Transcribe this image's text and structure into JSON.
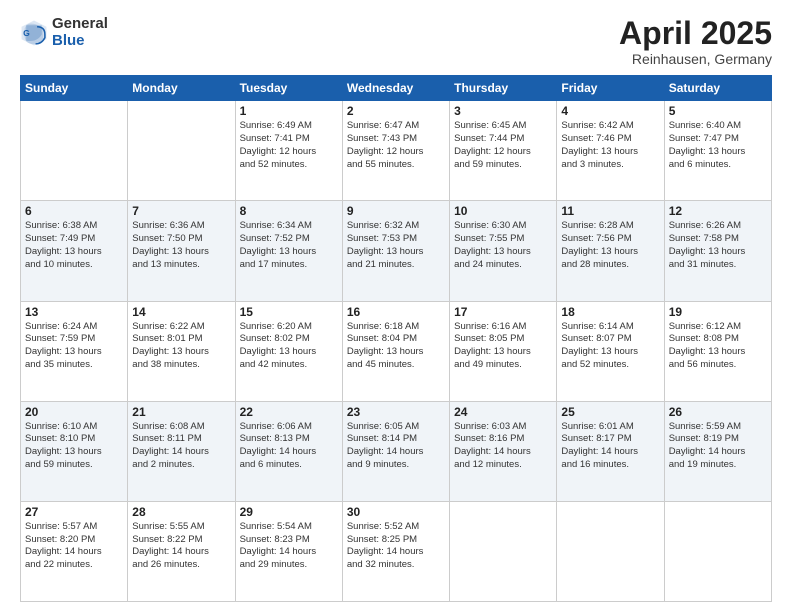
{
  "logo": {
    "general": "General",
    "blue": "Blue"
  },
  "header": {
    "title": "April 2025",
    "subtitle": "Reinhausen, Germany"
  },
  "days_of_week": [
    "Sunday",
    "Monday",
    "Tuesday",
    "Wednesday",
    "Thursday",
    "Friday",
    "Saturday"
  ],
  "weeks": [
    [
      {
        "day": null,
        "info": null
      },
      {
        "day": null,
        "info": null
      },
      {
        "day": "1",
        "info": "Sunrise: 6:49 AM\nSunset: 7:41 PM\nDaylight: 12 hours\nand 52 minutes."
      },
      {
        "day": "2",
        "info": "Sunrise: 6:47 AM\nSunset: 7:43 PM\nDaylight: 12 hours\nand 55 minutes."
      },
      {
        "day": "3",
        "info": "Sunrise: 6:45 AM\nSunset: 7:44 PM\nDaylight: 12 hours\nand 59 minutes."
      },
      {
        "day": "4",
        "info": "Sunrise: 6:42 AM\nSunset: 7:46 PM\nDaylight: 13 hours\nand 3 minutes."
      },
      {
        "day": "5",
        "info": "Sunrise: 6:40 AM\nSunset: 7:47 PM\nDaylight: 13 hours\nand 6 minutes."
      }
    ],
    [
      {
        "day": "6",
        "info": "Sunrise: 6:38 AM\nSunset: 7:49 PM\nDaylight: 13 hours\nand 10 minutes."
      },
      {
        "day": "7",
        "info": "Sunrise: 6:36 AM\nSunset: 7:50 PM\nDaylight: 13 hours\nand 13 minutes."
      },
      {
        "day": "8",
        "info": "Sunrise: 6:34 AM\nSunset: 7:52 PM\nDaylight: 13 hours\nand 17 minutes."
      },
      {
        "day": "9",
        "info": "Sunrise: 6:32 AM\nSunset: 7:53 PM\nDaylight: 13 hours\nand 21 minutes."
      },
      {
        "day": "10",
        "info": "Sunrise: 6:30 AM\nSunset: 7:55 PM\nDaylight: 13 hours\nand 24 minutes."
      },
      {
        "day": "11",
        "info": "Sunrise: 6:28 AM\nSunset: 7:56 PM\nDaylight: 13 hours\nand 28 minutes."
      },
      {
        "day": "12",
        "info": "Sunrise: 6:26 AM\nSunset: 7:58 PM\nDaylight: 13 hours\nand 31 minutes."
      }
    ],
    [
      {
        "day": "13",
        "info": "Sunrise: 6:24 AM\nSunset: 7:59 PM\nDaylight: 13 hours\nand 35 minutes."
      },
      {
        "day": "14",
        "info": "Sunrise: 6:22 AM\nSunset: 8:01 PM\nDaylight: 13 hours\nand 38 minutes."
      },
      {
        "day": "15",
        "info": "Sunrise: 6:20 AM\nSunset: 8:02 PM\nDaylight: 13 hours\nand 42 minutes."
      },
      {
        "day": "16",
        "info": "Sunrise: 6:18 AM\nSunset: 8:04 PM\nDaylight: 13 hours\nand 45 minutes."
      },
      {
        "day": "17",
        "info": "Sunrise: 6:16 AM\nSunset: 8:05 PM\nDaylight: 13 hours\nand 49 minutes."
      },
      {
        "day": "18",
        "info": "Sunrise: 6:14 AM\nSunset: 8:07 PM\nDaylight: 13 hours\nand 52 minutes."
      },
      {
        "day": "19",
        "info": "Sunrise: 6:12 AM\nSunset: 8:08 PM\nDaylight: 13 hours\nand 56 minutes."
      }
    ],
    [
      {
        "day": "20",
        "info": "Sunrise: 6:10 AM\nSunset: 8:10 PM\nDaylight: 13 hours\nand 59 minutes."
      },
      {
        "day": "21",
        "info": "Sunrise: 6:08 AM\nSunset: 8:11 PM\nDaylight: 14 hours\nand 2 minutes."
      },
      {
        "day": "22",
        "info": "Sunrise: 6:06 AM\nSunset: 8:13 PM\nDaylight: 14 hours\nand 6 minutes."
      },
      {
        "day": "23",
        "info": "Sunrise: 6:05 AM\nSunset: 8:14 PM\nDaylight: 14 hours\nand 9 minutes."
      },
      {
        "day": "24",
        "info": "Sunrise: 6:03 AM\nSunset: 8:16 PM\nDaylight: 14 hours\nand 12 minutes."
      },
      {
        "day": "25",
        "info": "Sunrise: 6:01 AM\nSunset: 8:17 PM\nDaylight: 14 hours\nand 16 minutes."
      },
      {
        "day": "26",
        "info": "Sunrise: 5:59 AM\nSunset: 8:19 PM\nDaylight: 14 hours\nand 19 minutes."
      }
    ],
    [
      {
        "day": "27",
        "info": "Sunrise: 5:57 AM\nSunset: 8:20 PM\nDaylight: 14 hours\nand 22 minutes."
      },
      {
        "day": "28",
        "info": "Sunrise: 5:55 AM\nSunset: 8:22 PM\nDaylight: 14 hours\nand 26 minutes."
      },
      {
        "day": "29",
        "info": "Sunrise: 5:54 AM\nSunset: 8:23 PM\nDaylight: 14 hours\nand 29 minutes."
      },
      {
        "day": "30",
        "info": "Sunrise: 5:52 AM\nSunset: 8:25 PM\nDaylight: 14 hours\nand 32 minutes."
      },
      {
        "day": null,
        "info": null
      },
      {
        "day": null,
        "info": null
      },
      {
        "day": null,
        "info": null
      }
    ]
  ]
}
